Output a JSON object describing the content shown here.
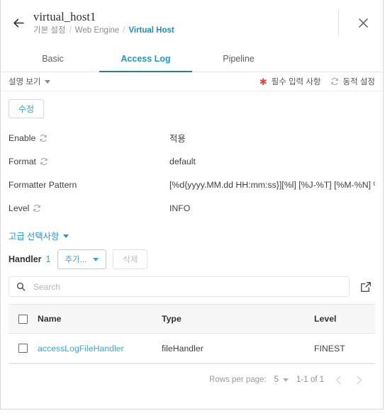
{
  "header": {
    "back_icon": "arrow-left-icon",
    "title": "virtual_host1",
    "close_icon": "close-icon",
    "breadcrumb": [
      {
        "label": "기본 설정",
        "current": false
      },
      {
        "label": "Web Engine",
        "current": false
      },
      {
        "label": "Virtual Host",
        "current": true
      }
    ],
    "separator": "/"
  },
  "tabs": [
    {
      "label": "Basic",
      "active": false
    },
    {
      "label": "Access Log",
      "active": true
    },
    {
      "label": "Pipeline",
      "active": false
    }
  ],
  "metabar": {
    "description_toggle": "설명 보기",
    "required_marker": "✱",
    "required_text": "필수 입력 사항",
    "dynamic_icon": "dynamic-settings-icon",
    "dynamic_text": "동적 설정"
  },
  "actions": {
    "edit_label": "수정"
  },
  "properties": [
    {
      "label": "Enable",
      "dynamic": true,
      "value": "적용"
    },
    {
      "label": "Format",
      "dynamic": true,
      "value": "default"
    },
    {
      "label": "Formatter Pattern",
      "dynamic": false,
      "value": "[%d{yyyy.MM.dd HH:mm:ss}][%l] [%J-%T] [%M-%N] %m"
    },
    {
      "label": "Level",
      "dynamic": true,
      "value": "INFO"
    }
  ],
  "advanced": {
    "label": "고급 선택사항"
  },
  "handler": {
    "label": "Handler",
    "count": "1",
    "add_label": "추가...",
    "delete_label": "삭제"
  },
  "search": {
    "placeholder": "Search",
    "value": "",
    "icon": "search-icon",
    "external_icon": "external-link-icon"
  },
  "table": {
    "columns": [
      "Name",
      "Type",
      "Level"
    ],
    "rows": [
      {
        "name": "accessLogFileHandler",
        "type": "fileHandler",
        "level": "FINEST"
      }
    ]
  },
  "pagination": {
    "rows_per_page_label": "Rows per page:",
    "rows_per_page_value": "5",
    "range": "1-1 of 1",
    "prev_icon": "chevron-left-icon",
    "next_icon": "chevron-right-icon"
  },
  "colors": {
    "accent": "#1b9ad1",
    "tab_underline": "#2a7f8f",
    "required": "#e0453a",
    "link": "#3aa8d8"
  }
}
